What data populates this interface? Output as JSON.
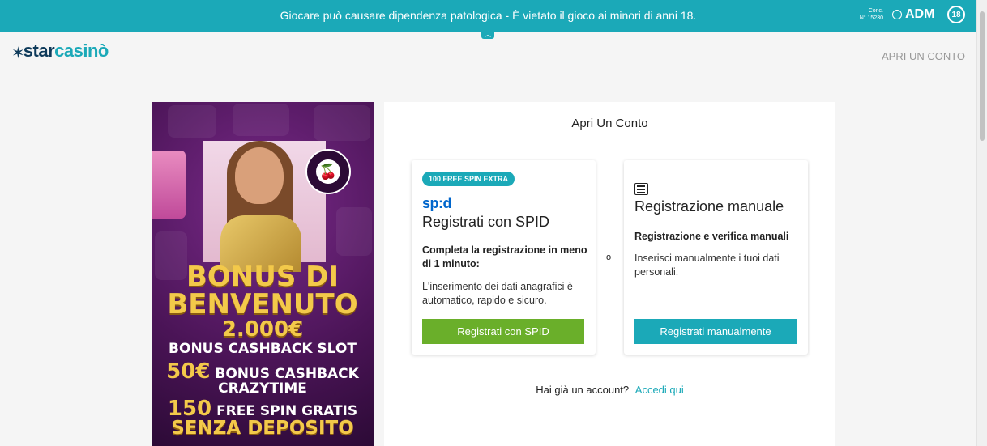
{
  "banner": {
    "warning_text": "Giocare può causare dipendenza patologica - È vietato il gioco ai minori di anni 18.",
    "conc_label": "Conc.",
    "conc_number": "N° 15230",
    "adm_label": "ADM",
    "age_badge": "18",
    "toggle_icon": "chevron-up-icon"
  },
  "header": {
    "logo_star": "star",
    "logo_casino": "casinò",
    "open_account_link": "APRI UN CONTO"
  },
  "promo": {
    "cherry_icon": "🍒",
    "title_line1": "BONUS DI",
    "title_line2": "BENVENUTO",
    "amount": "2.000€",
    "line1": "BONUS CASHBACK SLOT",
    "line2_amount": "50€",
    "line2_text": "BONUS CASHBACK",
    "line3": "CRAZYTIME",
    "line4_amount": "150",
    "line4_text": "FREE SPIN GRATIS",
    "line5": "SENZA DEPOSITO"
  },
  "main": {
    "title": "Apri Un Conto",
    "or_label": "o",
    "spid": {
      "badge": "100 FREE SPIN EXTRA",
      "logo": "sp:d",
      "title": "Registrati con SPID",
      "subtitle": "Completa la registrazione in meno di 1 minuto:",
      "description": "L'inserimento dei dati anagrafici è automatico, rapido e sicuro.",
      "button": "Registrati con SPID"
    },
    "manual": {
      "icon": "form-icon",
      "title": "Registrazione manuale",
      "subtitle": "Registrazione e verifica manuali",
      "description": "Inserisci manualmente i tuoi dati personali.",
      "button": "Registrati manualmente"
    },
    "login_prompt": "Hai già un account?",
    "login_link": "Accedi qui"
  },
  "colors": {
    "brand_teal": "#1ba9b8",
    "spid_green": "#6aaf2a",
    "spid_blue": "#0066cc",
    "logo_navy": "#0e3a5a"
  }
}
